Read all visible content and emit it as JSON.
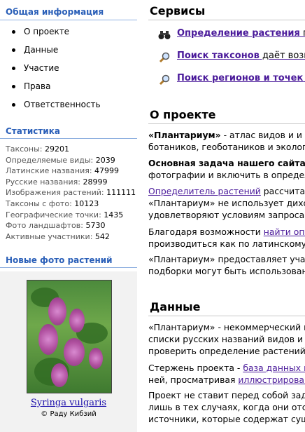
{
  "sidebar": {
    "general_title": "Общая информация",
    "nav": [
      "О проекте",
      "Данные",
      "Участие",
      "Права",
      "Ответственность"
    ],
    "stats_title": "Статистика",
    "stats": [
      {
        "label": "Таксоны:",
        "value": "29201"
      },
      {
        "label": "Определяемые виды:",
        "value": "2039"
      },
      {
        "label": "Латинские названия:",
        "value": "47999"
      },
      {
        "label": "Русские названия:",
        "value": "28999"
      },
      {
        "label": "Изображения растений:",
        "value": "111111"
      },
      {
        "label": "Таксоны с фото:",
        "value": "10123"
      },
      {
        "label": "Географические точки:",
        "value": "1435"
      },
      {
        "label": "Фото ландшафтов:",
        "value": "5730"
      },
      {
        "label": "Активные участники:",
        "value": "542"
      }
    ],
    "photos_title": "Новые фото растений",
    "photo_caption": "Syringa vulgaris",
    "photo_credit": "© Раду Кибзий"
  },
  "main": {
    "services_title": "Сервисы",
    "services": [
      {
        "icon": "binoculars-icon",
        "link": "Определение растения",
        "rest": " по"
      },
      {
        "icon": "magnifier-icon",
        "link": "Поиск таксонов",
        "rest": " даёт возм"
      },
      {
        "icon": "magnifier-icon",
        "link": "Поиск регионов и точек",
        "rest": " в"
      }
    ],
    "about_title": "О проекте",
    "about": {
      "p1_bold": "«Плантариум»",
      "p1_rest": " - атлас видов и и",
      "p1_line2": "ботаников, геоботаников и эколог",
      "p2_bold": "Основная задача нашего сайта",
      "p2_line2": "фотографии и включить в определ",
      "p3_link": "Определитель растений",
      "p3_rest": " рассчитан",
      "p3_line2": "«Плантариум» не использует дихо",
      "p3_line3": "удовлетворяют условиям запроса",
      "p4_text": "Благодаря возможности ",
      "p4_link": "найти опи",
      "p4_line2": "производиться как по латинскому",
      "p5_text": "«Плантариум» предоставляет уча",
      "p5_line2": "подборки могут быть использован"
    },
    "data_title": "Данные",
    "data": {
      "p1_line1": "«Плантариум» - некоммерческий п",
      "p1_line2": "списки русских названий видов и",
      "p1_line3": "проверить определение растений.",
      "p2_text": "Стержень проекта - ",
      "p2_link": "база данных п",
      "p2_line2_text": "ней, просматривая ",
      "p2_line2_link": "иллюстрирован",
      "p3_line1": "Проект не ставит перед собой зад",
      "p3_line2": "лишь в тех случаях, когда они отс",
      "p3_line3": "источники, которые содержат сущ"
    }
  }
}
